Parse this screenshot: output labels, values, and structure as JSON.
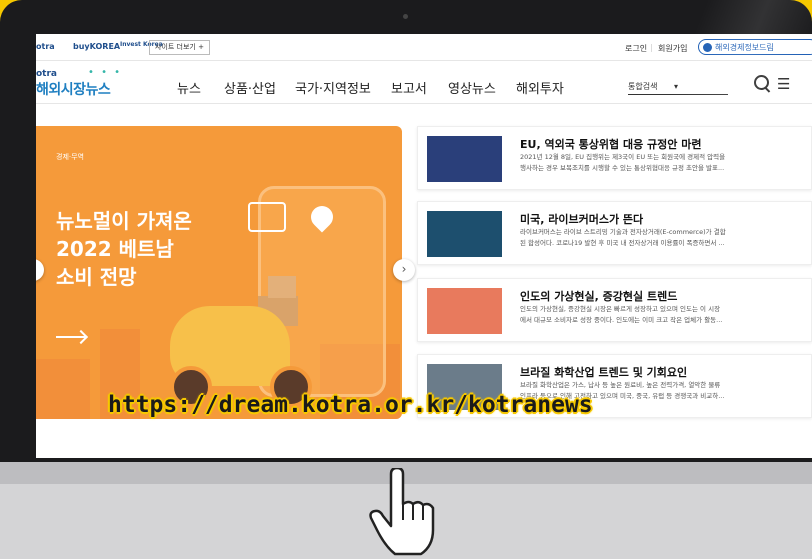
{
  "topbar": {
    "logos": [
      "otra",
      "buyKOREA",
      "Invest Korea"
    ],
    "sitemap_label": "사이트 더보기 +",
    "login_label": "로그인",
    "separator": "|",
    "signup_label": "회원가입",
    "report_label": "해외경제정보드림"
  },
  "nav": {
    "brand_small": "otra",
    "brand_title": "해외시장뉴스",
    "brand_dots": "• • •",
    "menu": [
      "뉴스",
      "상품·산업",
      "국가·지역정보",
      "보고서",
      "영상뉴스",
      "해외투자"
    ],
    "search_select": "통합검색",
    "search_caret": "▾",
    "hamburger": "☰"
  },
  "banner": {
    "category": "경제·무역",
    "title_lines": [
      "뉴노멀이 가져온",
      "2022 베트남",
      "소비 전망"
    ],
    "next_arrow": "›"
  },
  "news": [
    {
      "title": "EU, 역외국 통상위협 대응 규정안 마련",
      "desc_lines": [
        "2021년 12월 8일, EU 집행위는 제3국이 EU 또는 회원국에 경제적 압력을",
        "행사하는 경우 보복조치를 시행할 수 있는 통상위협대응 규정 초안을 발표..."
      ],
      "thumb_color": "#2a3f7a"
    },
    {
      "title": "미국, 라이브커머스가 뜬다",
      "desc_lines": [
        "라이브커머스는 라이브 스트리밍 기술과 전자상거래(E-commerce)가 결합",
        "된 합성어다. 코로나19 발현 후 미국 내 전자상거래 이용률이 폭증하면서 ..."
      ],
      "thumb_color": "#1d4f6e"
    },
    {
      "title": "인도의 가상현실, 증강현실 트렌드",
      "desc_lines": [
        "인도의 가상현실, 증강현실 시장은 빠르게 성장하고 있으며 인도는 이 시장",
        "에서 대규모 소비자로 성장 중이다. 인도에는 이미 크고 작은 업체가 활동..."
      ],
      "thumb_color": "#e87a5d"
    },
    {
      "title": "브라질 화학산업 트렌드 및 기회요인",
      "desc_lines": [
        "브라질 화학산업은 가스, 납사 등 높은 원료비, 높은 전력가격, 열악한 물류",
        "인프라 등으로 인해 고전하고 있으며 미국, 중국, 유럽 등 경쟁국과 비교하..."
      ],
      "thumb_color": "#6b7c8a"
    }
  ],
  "overlay_url": "https://dream.kotra.or.kr/kotranews",
  "icons": {
    "search": "search-icon",
    "menu": "hamburger-icon",
    "pointer": "hand-pointer-icon"
  },
  "colors": {
    "background": "#f6c800",
    "banner": "#f59a3a",
    "accent": "#1f5fb5"
  }
}
